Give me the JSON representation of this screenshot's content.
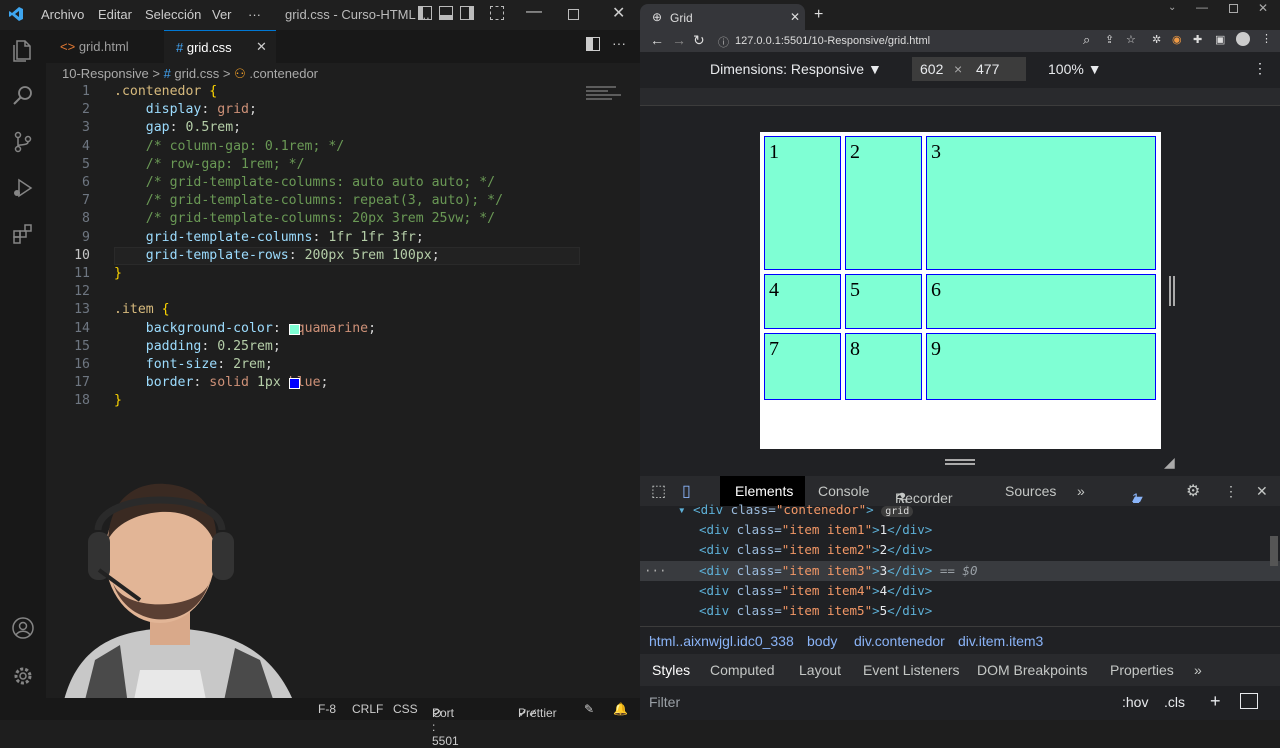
{
  "vscode": {
    "menu": [
      "Archivo",
      "Editar",
      "Selección",
      "Ver",
      "···"
    ],
    "window_title": "grid.css - Curso-HTML ...",
    "tabs": [
      {
        "label": "grid.html",
        "icon": "<>"
      },
      {
        "label": "grid.css",
        "icon": "#"
      }
    ],
    "breadcrumb": [
      "10-Responsive",
      ">",
      "grid.css",
      ">",
      ".contenedor"
    ],
    "code": [
      {
        "n": "1",
        "t": ".contenedor {"
      },
      {
        "n": "2",
        "t": "    display: grid;"
      },
      {
        "n": "3",
        "t": "    gap: 0.5rem;"
      },
      {
        "n": "4",
        "t": "    /* column-gap: 0.1rem; */"
      },
      {
        "n": "5",
        "t": "    /* row-gap: 1rem; */"
      },
      {
        "n": "6",
        "t": "    /* grid-template-columns: auto auto auto; */"
      },
      {
        "n": "7",
        "t": "    /* grid-template-columns: repeat(3, auto); */"
      },
      {
        "n": "8",
        "t": "    /* grid-template-columns: 20px 3rem 25vw; */"
      },
      {
        "n": "9",
        "t": "    grid-template-columns: 1fr 1fr 3fr;"
      },
      {
        "n": "10",
        "t": "    grid-template-rows: 200px 5rem 100px;"
      },
      {
        "n": "11",
        "t": "}"
      },
      {
        "n": "12",
        "t": ""
      },
      {
        "n": "13",
        "t": ".item {"
      },
      {
        "n": "14",
        "t": "    background-color: aquamarine;"
      },
      {
        "n": "15",
        "t": "    padding: 0.25rem;"
      },
      {
        "n": "16",
        "t": "    font-size: 2rem;"
      },
      {
        "n": "17",
        "t": "    border: solid 1px blue;"
      },
      {
        "n": "18",
        "t": "}"
      }
    ],
    "status": [
      "F-8",
      "CRLF",
      "CSS",
      "Port : 5501",
      "Prettier"
    ]
  },
  "chrome": {
    "tab_title": "Grid",
    "url": "127.0.0.1:5501/10-Responsive/grid.html",
    "dimensions_label": "Dimensions: Responsive",
    "width": "602",
    "height": "477",
    "times": "×",
    "zoom": "100%",
    "grid_items": [
      "1",
      "2",
      "3",
      "4",
      "5",
      "6",
      "7",
      "8",
      "9"
    ],
    "devtools_tabs": [
      "Elements",
      "Console",
      "Recorder",
      "Sources",
      "»"
    ],
    "issues": "1",
    "dom_lines": [
      {
        "pre": "▾ <",
        "tag": "div",
        "attr": " class=",
        "val": "\"contenedor\"",
        "close": ">",
        "badge": "grid"
      },
      {
        "pre": "<",
        "tag": "div",
        "attr": " class=",
        "val": "\"item item1\"",
        "close": ">1</div>"
      },
      {
        "pre": "<",
        "tag": "div",
        "attr": " class=",
        "val": "\"item item2\"",
        "close": ">2</div>"
      },
      {
        "pre": "<",
        "tag": "div",
        "attr": " class=",
        "val": "\"item item3\"",
        "close": ">3</div>",
        "extra": " == $0"
      },
      {
        "pre": "<",
        "tag": "div",
        "attr": " class=",
        "val": "\"item item4\"",
        "close": ">4</div>"
      },
      {
        "pre": "<",
        "tag": "div",
        "attr": " class=",
        "val": "\"item item5\"",
        "close": ">5</div>"
      }
    ],
    "crumbs": [
      "html..aixnwjgl.idc0_338",
      "body",
      "div.contenedor",
      "div.item.item3"
    ],
    "style_tabs": [
      "Styles",
      "Computed",
      "Layout",
      "Event Listeners",
      "DOM Breakpoints",
      "Properties",
      "»"
    ],
    "filter_placeholder": "Filter",
    "filter_tools": [
      ":hov",
      ".cls",
      "+"
    ]
  },
  "colors": {
    "aquamarine": "#7fffd4",
    "blue": "#0000ff"
  }
}
